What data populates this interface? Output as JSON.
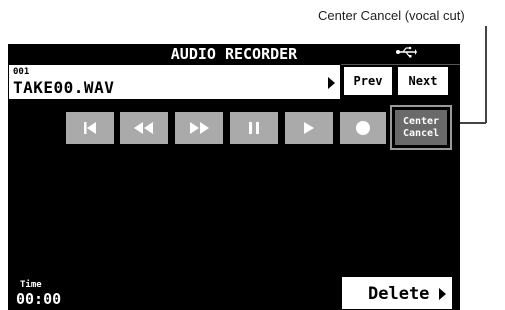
{
  "callout": {
    "text": "Center Cancel (vocal cut)"
  },
  "screen": {
    "title": "AUDIO RECORDER",
    "usb_icon": "usb-icon"
  },
  "file": {
    "number": "001",
    "name": "TAKE00.WAV"
  },
  "nav": {
    "prev_label": "Prev",
    "next_label": "Next"
  },
  "transport": {
    "buttons": [
      "skip-to-start-icon",
      "rewind-icon",
      "fast-forward-icon",
      "pause-icon",
      "play-icon",
      "record-icon"
    ]
  },
  "center_cancel": {
    "line1": "Center",
    "line2": "Cancel"
  },
  "time": {
    "label": "Time",
    "value": "00:00"
  },
  "delete": {
    "label": "Delete"
  },
  "colors": {
    "screen_bg": "#000000",
    "button_gray": "#aaaaaa",
    "center_cancel_bg": "#6a6a6a",
    "highlight_border": "#9a9a9a"
  }
}
